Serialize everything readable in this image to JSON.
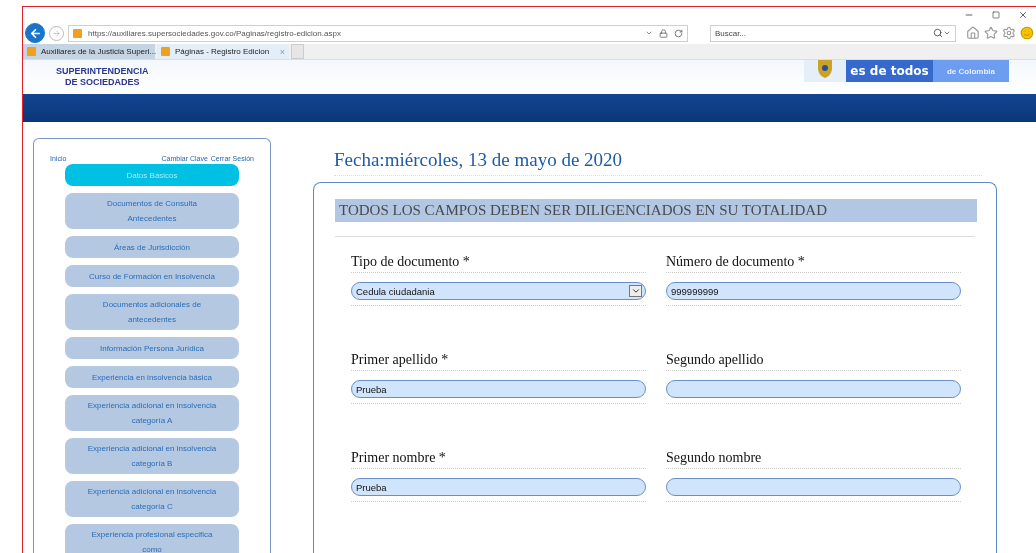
{
  "browser": {
    "url": "https://auxiliares.supersociedades.gov.co/Paginas/registro-edicion.aspx",
    "search_placeholder": "Buscar...",
    "tabs": [
      {
        "label": "Auxiliares de la Justicia Superi...",
        "selected": false
      },
      {
        "label": "Páginas - Registro Edicion",
        "selected": true,
        "close": "×"
      }
    ]
  },
  "header": {
    "logo_lines": [
      "SUPERINTENDENCIA",
      "DE SOCIEDADES"
    ],
    "banner": [
      "es de todos",
      "de Colombia"
    ]
  },
  "sidebar": {
    "links": [
      "Inicio",
      "Cambiar Clave",
      "Cerrar Sesión"
    ],
    "items": [
      {
        "label": "Datos Básicos",
        "selected": true
      },
      {
        "label": "Documentos de Consulta Antecedentes",
        "selected": false
      },
      {
        "label": "Áreas de Jurisdicción",
        "selected": false
      },
      {
        "label": "Curso de Formación en Insolvencia",
        "selected": false
      },
      {
        "label": "Documentos adicionales de antecedentes",
        "selected": false
      },
      {
        "label": "Información Persona Jurídica",
        "selected": false
      },
      {
        "label": "Experiencia en insolvencia básica",
        "selected": false
      },
      {
        "label": "Experiencia adicional en insolvencia categoría A",
        "selected": false
      },
      {
        "label": "Experiencia adicional en insolvencia categoría B",
        "selected": false
      },
      {
        "label": "Experiencia adicional en insolvencia categoría C",
        "selected": false
      },
      {
        "label": "Experiencia profesional especifica como",
        "selected": false
      }
    ]
  },
  "main": {
    "date": "Fecha:miércoles, 13 de mayo de 2020",
    "notice": "TODOS LOS CAMPOS DEBEN SER DILIGENCIADOS EN SU TOTALIDAD",
    "fields": [
      {
        "label": "Tipo de documento *",
        "kind": "select",
        "value": "Cedula ciudadania"
      },
      {
        "label": "Número de documento *",
        "kind": "text",
        "value": "999999999"
      },
      {
        "label": "Primer apellido *",
        "kind": "text",
        "value": "Prueba"
      },
      {
        "label": "Segundo apellido",
        "kind": "text"
      },
      {
        "label": "Primer nombre *",
        "kind": "text",
        "value": "Prueba"
      },
      {
        "label": "Segundo nombre",
        "kind": "text"
      }
    ]
  }
}
